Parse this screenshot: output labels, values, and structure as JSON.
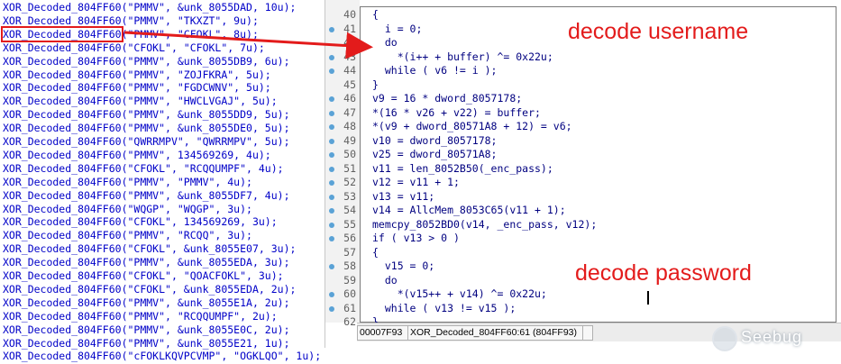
{
  "xrefs": [
    {
      "fn": "XOR_Decoded_804FF60",
      "args": "(\"PMMV\", &unk_8055DAD, 10u);"
    },
    {
      "fn": "XOR_Decoded_804FF60",
      "args": "(\"PMMV\", \"TKXZT\", 9u);"
    },
    {
      "fn": "XOR_Decoded_804FF60",
      "args": "(\"PMMV\", \"CFOKL\", 8u);",
      "highlight": true
    },
    {
      "fn": "XOR_Decoded_804FF60",
      "args": "(\"CFOKL\", \"CFOKL\", 7u);"
    },
    {
      "fn": "XOR_Decoded_804FF60",
      "args": "(\"PMMV\", &unk_8055DB9, 6u);"
    },
    {
      "fn": "XOR_Decoded_804FF60",
      "args": "(\"PMMV\", \"ZOJFKRA\", 5u);"
    },
    {
      "fn": "XOR_Decoded_804FF60",
      "args": "(\"PMMV\", \"FGDCWNV\", 5u);"
    },
    {
      "fn": "XOR_Decoded_804FF60",
      "args": "(\"PMMV\", \"HWCLVGAJ\", 5u);"
    },
    {
      "fn": "XOR_Decoded_804FF60",
      "args": "(\"PMMV\", &unk_8055DD9, 5u);"
    },
    {
      "fn": "XOR_Decoded_804FF60",
      "args": "(\"PMMV\", &unk_8055DE0, 5u);"
    },
    {
      "fn": "XOR_Decoded_804FF60",
      "args": "(\"QWRRMPV\", \"QWRRMPV\", 5u);"
    },
    {
      "fn": "XOR_Decoded_804FF60",
      "args": "(\"PMMV\", 134569269, 4u);"
    },
    {
      "fn": "XOR_Decoded_804FF60",
      "args": "(\"CFOKL\", \"RCQQUMPF\", 4u);"
    },
    {
      "fn": "XOR_Decoded_804FF60",
      "args": "(\"PMMV\", \"PMMV\", 4u);"
    },
    {
      "fn": "XOR_Decoded_804FF60",
      "args": "(\"PMMV\", &unk_8055DF7, 4u);"
    },
    {
      "fn": "XOR_Decoded_804FF60",
      "args": "(\"WQGP\", \"WQGP\", 3u);"
    },
    {
      "fn": "XOR_Decoded_804FF60",
      "args": "(\"CFOKL\", 134569269, 3u);"
    },
    {
      "fn": "XOR_Decoded_804FF60",
      "args": "(\"PMMV\", \"RCQQ\", 3u);"
    },
    {
      "fn": "XOR_Decoded_804FF60",
      "args": "(\"CFOKL\", &unk_8055E07, 3u);"
    },
    {
      "fn": "XOR_Decoded_804FF60",
      "args": "(\"PMMV\", &unk_8055EDA, 3u);"
    },
    {
      "fn": "XOR_Decoded_804FF60",
      "args": "(\"CFOKL\", \"QOACFOKL\", 3u);"
    },
    {
      "fn": "XOR_Decoded_804FF60",
      "args": "(\"CFOKL\", &unk_8055EDA, 2u);"
    },
    {
      "fn": "XOR_Decoded_804FF60",
      "args": "(\"PMMV\", &unk_8055E1A, 2u);"
    },
    {
      "fn": "XOR_Decoded_804FF60",
      "args": "(\"PMMV\", \"RCQQUMPF\", 2u);"
    },
    {
      "fn": "XOR_Decoded_804FF60",
      "args": "(\"PMMV\", &unk_8055E0C, 2u);"
    },
    {
      "fn": "XOR_Decoded_804FF60",
      "args": "(\"PMMV\", &unk_8055E21, 1u);"
    },
    {
      "fn": "XOR_Decoded_804FF60",
      "args": "(\"cFOKLKQVPCVMP\", \"OGKLQO\", 1u);"
    }
  ],
  "code": [
    {
      "ln": "40",
      "text": "{",
      "dot": false
    },
    {
      "ln": "41",
      "text": "  i = 0;",
      "dot": true
    },
    {
      "ln": "42",
      "text": "  do",
      "dot": false
    },
    {
      "ln": "43",
      "text": "    *(i++ + buffer) ^= 0x22u;",
      "dot": true
    },
    {
      "ln": "44",
      "text": "  while ( v6 != i );",
      "dot": true
    },
    {
      "ln": "45",
      "text": "}",
      "dot": false
    },
    {
      "ln": "46",
      "text": "v9 = 16 * dword_8057178;",
      "dot": true
    },
    {
      "ln": "47",
      "text": "*(16 * v26 + v22) = buffer;",
      "dot": true
    },
    {
      "ln": "48",
      "text": "*(v9 + dword_80571A8 + 12) = v6;",
      "dot": true
    },
    {
      "ln": "49",
      "text": "v10 = dword_8057178;",
      "dot": true
    },
    {
      "ln": "50",
      "text": "v25 = dword_80571A8;",
      "dot": true
    },
    {
      "ln": "51",
      "text": "v11 = len_8052B50(_enc_pass);",
      "dot": true
    },
    {
      "ln": "52",
      "text": "v12 = v11 + 1;",
      "dot": true
    },
    {
      "ln": "53",
      "text": "v13 = v11;",
      "dot": true
    },
    {
      "ln": "54",
      "text": "v14 = AllcMem_8053C65(v11 + 1);",
      "dot": true
    },
    {
      "ln": "55",
      "text": "memcpy_8052BD0(v14, _enc_pass, v12);",
      "dot": true
    },
    {
      "ln": "56",
      "text": "if ( v13 > 0 )",
      "dot": true
    },
    {
      "ln": "57",
      "text": "{",
      "dot": false
    },
    {
      "ln": "58",
      "text": "  v15 = 0;",
      "dot": true
    },
    {
      "ln": "59",
      "text": "  do",
      "dot": false
    },
    {
      "ln": "60",
      "text": "    *(v15++ + v14) ^= 0x22u;",
      "dot": true
    },
    {
      "ln": "61",
      "text": "  while ( v13 != v15 );",
      "dot": true
    },
    {
      "ln": "62",
      "text": "}",
      "dot": false
    }
  ],
  "status": {
    "address": "00007F93",
    "location": "XOR_Decoded_804FF60:61 (804FF93)",
    "extra": ""
  },
  "annotations": {
    "username": "decode username",
    "password": "decode password"
  },
  "watermark": "Seebug",
  "colors": {
    "annotation": "#e31b1b",
    "function_text": "#0000c8",
    "breakpoint_dot": "#5aa2d6"
  }
}
